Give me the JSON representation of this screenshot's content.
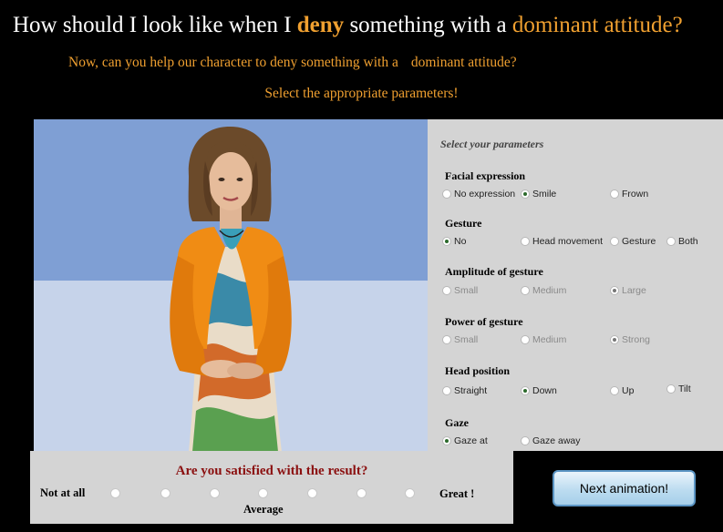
{
  "header": {
    "title_prefix": "How should I look like when I",
    "title_verb": "deny",
    "title_mid": "something with a",
    "title_attitude": "dominant attitude?",
    "subtitle_part1": "Now, can you help our character to deny something with a",
    "subtitle_part2": "dominant attitude?",
    "instruction": "Select the appropriate parameters!"
  },
  "scene": {
    "background_top": "#7f9fd4",
    "background_floor": "#c6d3ea",
    "jacket_color": "#f08c14"
  },
  "panel": {
    "heading": "Select your parameters",
    "groups": [
      {
        "title": "Facial expression",
        "enabled": true,
        "options": [
          {
            "label": "No expression",
            "selected": false
          },
          {
            "label": "Smile",
            "selected": true
          },
          {
            "label": "Frown",
            "selected": false
          }
        ]
      },
      {
        "title": "Gesture",
        "enabled": true,
        "options": [
          {
            "label": "No",
            "selected": true
          },
          {
            "label": "Head movement",
            "selected": false
          },
          {
            "label": "Gesture",
            "selected": false
          },
          {
            "label": "Both",
            "selected": false
          }
        ]
      },
      {
        "title": "Amplitude of gesture",
        "enabled": false,
        "options": [
          {
            "label": "Small",
            "selected": false
          },
          {
            "label": "Medium",
            "selected": false
          },
          {
            "label": "Large",
            "selected": true
          }
        ]
      },
      {
        "title": "Power of gesture",
        "enabled": false,
        "options": [
          {
            "label": "Small",
            "selected": false
          },
          {
            "label": "Medium",
            "selected": false
          },
          {
            "label": "Strong",
            "selected": true
          }
        ]
      },
      {
        "title": "Head position",
        "enabled": true,
        "options": [
          {
            "label": "Straight",
            "selected": false
          },
          {
            "label": "Down",
            "selected": true
          },
          {
            "label": "Up",
            "selected": false
          },
          {
            "label": "Tilt",
            "selected": false
          }
        ]
      },
      {
        "title": "Gaze",
        "enabled": true,
        "options": [
          {
            "label": "Gaze at",
            "selected": true
          },
          {
            "label": "Gaze away",
            "selected": false
          }
        ]
      }
    ]
  },
  "survey": {
    "question": "Are you satisfied with the result?",
    "low_label": "Not at all",
    "mid_label": "Average",
    "high_label": "Great !",
    "scale_points": 7
  },
  "next_button": {
    "label": "Next animation!"
  }
}
